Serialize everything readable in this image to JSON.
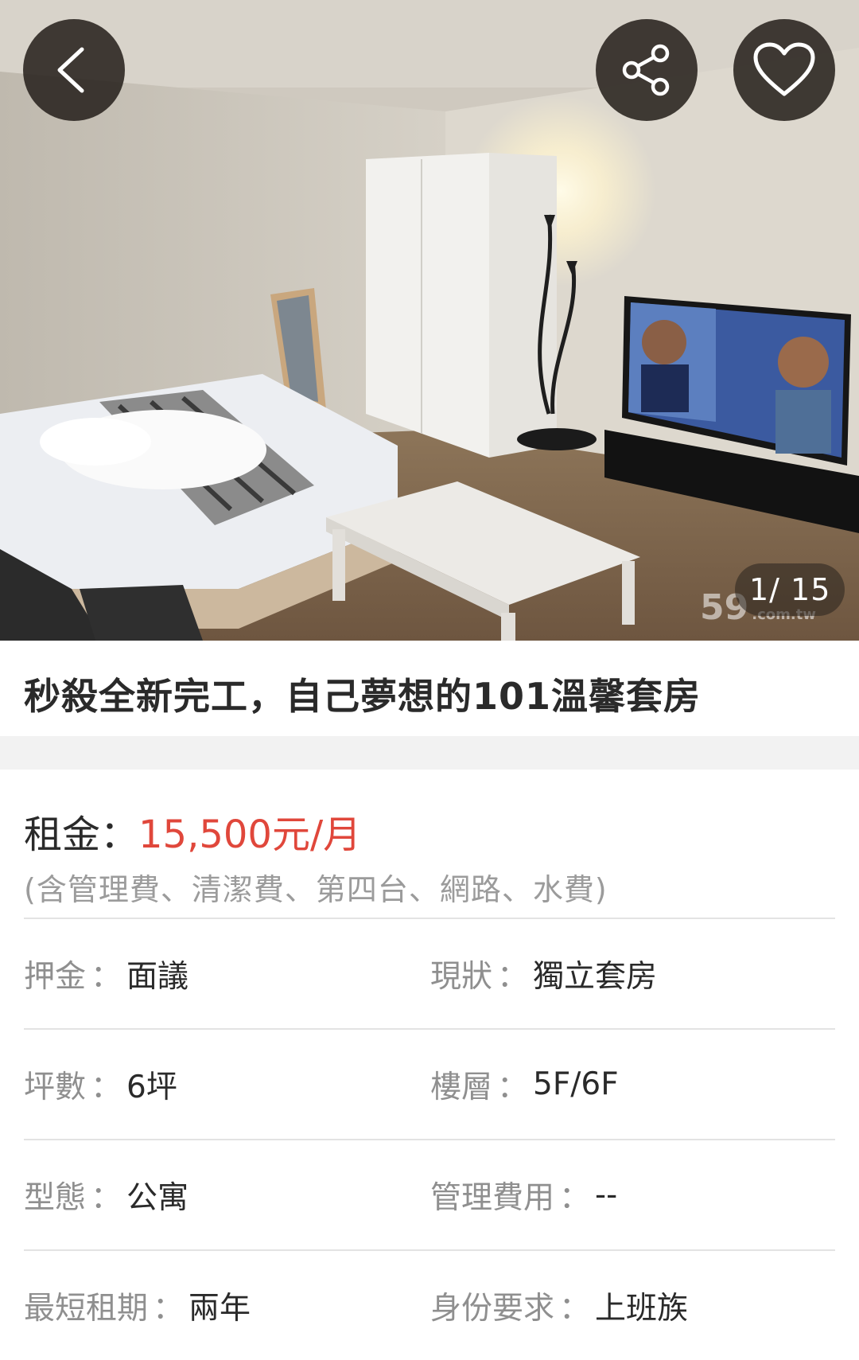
{
  "gallery": {
    "counter": "1/ 15",
    "watermark_main": "59",
    "watermark_sub": ".com.tw"
  },
  "actions": {
    "back_icon": "chevron-left-icon",
    "share_icon": "share-icon",
    "favorite_icon": "heart-outline-icon"
  },
  "listing": {
    "title": "秒殺全新完工，自己夢想的101溫馨套房"
  },
  "rent": {
    "label": "租金：",
    "value": "15,500元/月",
    "note": "(含管理費、清潔費、第四台、網路、水費)",
    "value_color": "#e0473b"
  },
  "details": [
    {
      "left_label": "押金",
      "left_value": "面議",
      "right_label": "現狀",
      "right_value": "獨立套房"
    },
    {
      "left_label": "坪數",
      "left_value": "6坪",
      "right_label": "樓層",
      "right_value": "5F/6F"
    },
    {
      "left_label": "型態",
      "left_value": "公寓",
      "right_label": "管理費用",
      "right_value": "--"
    },
    {
      "left_label": "最短租期",
      "left_value": "兩年",
      "right_label": "身份要求",
      "right_value": "上班族"
    }
  ],
  "separator": "："
}
